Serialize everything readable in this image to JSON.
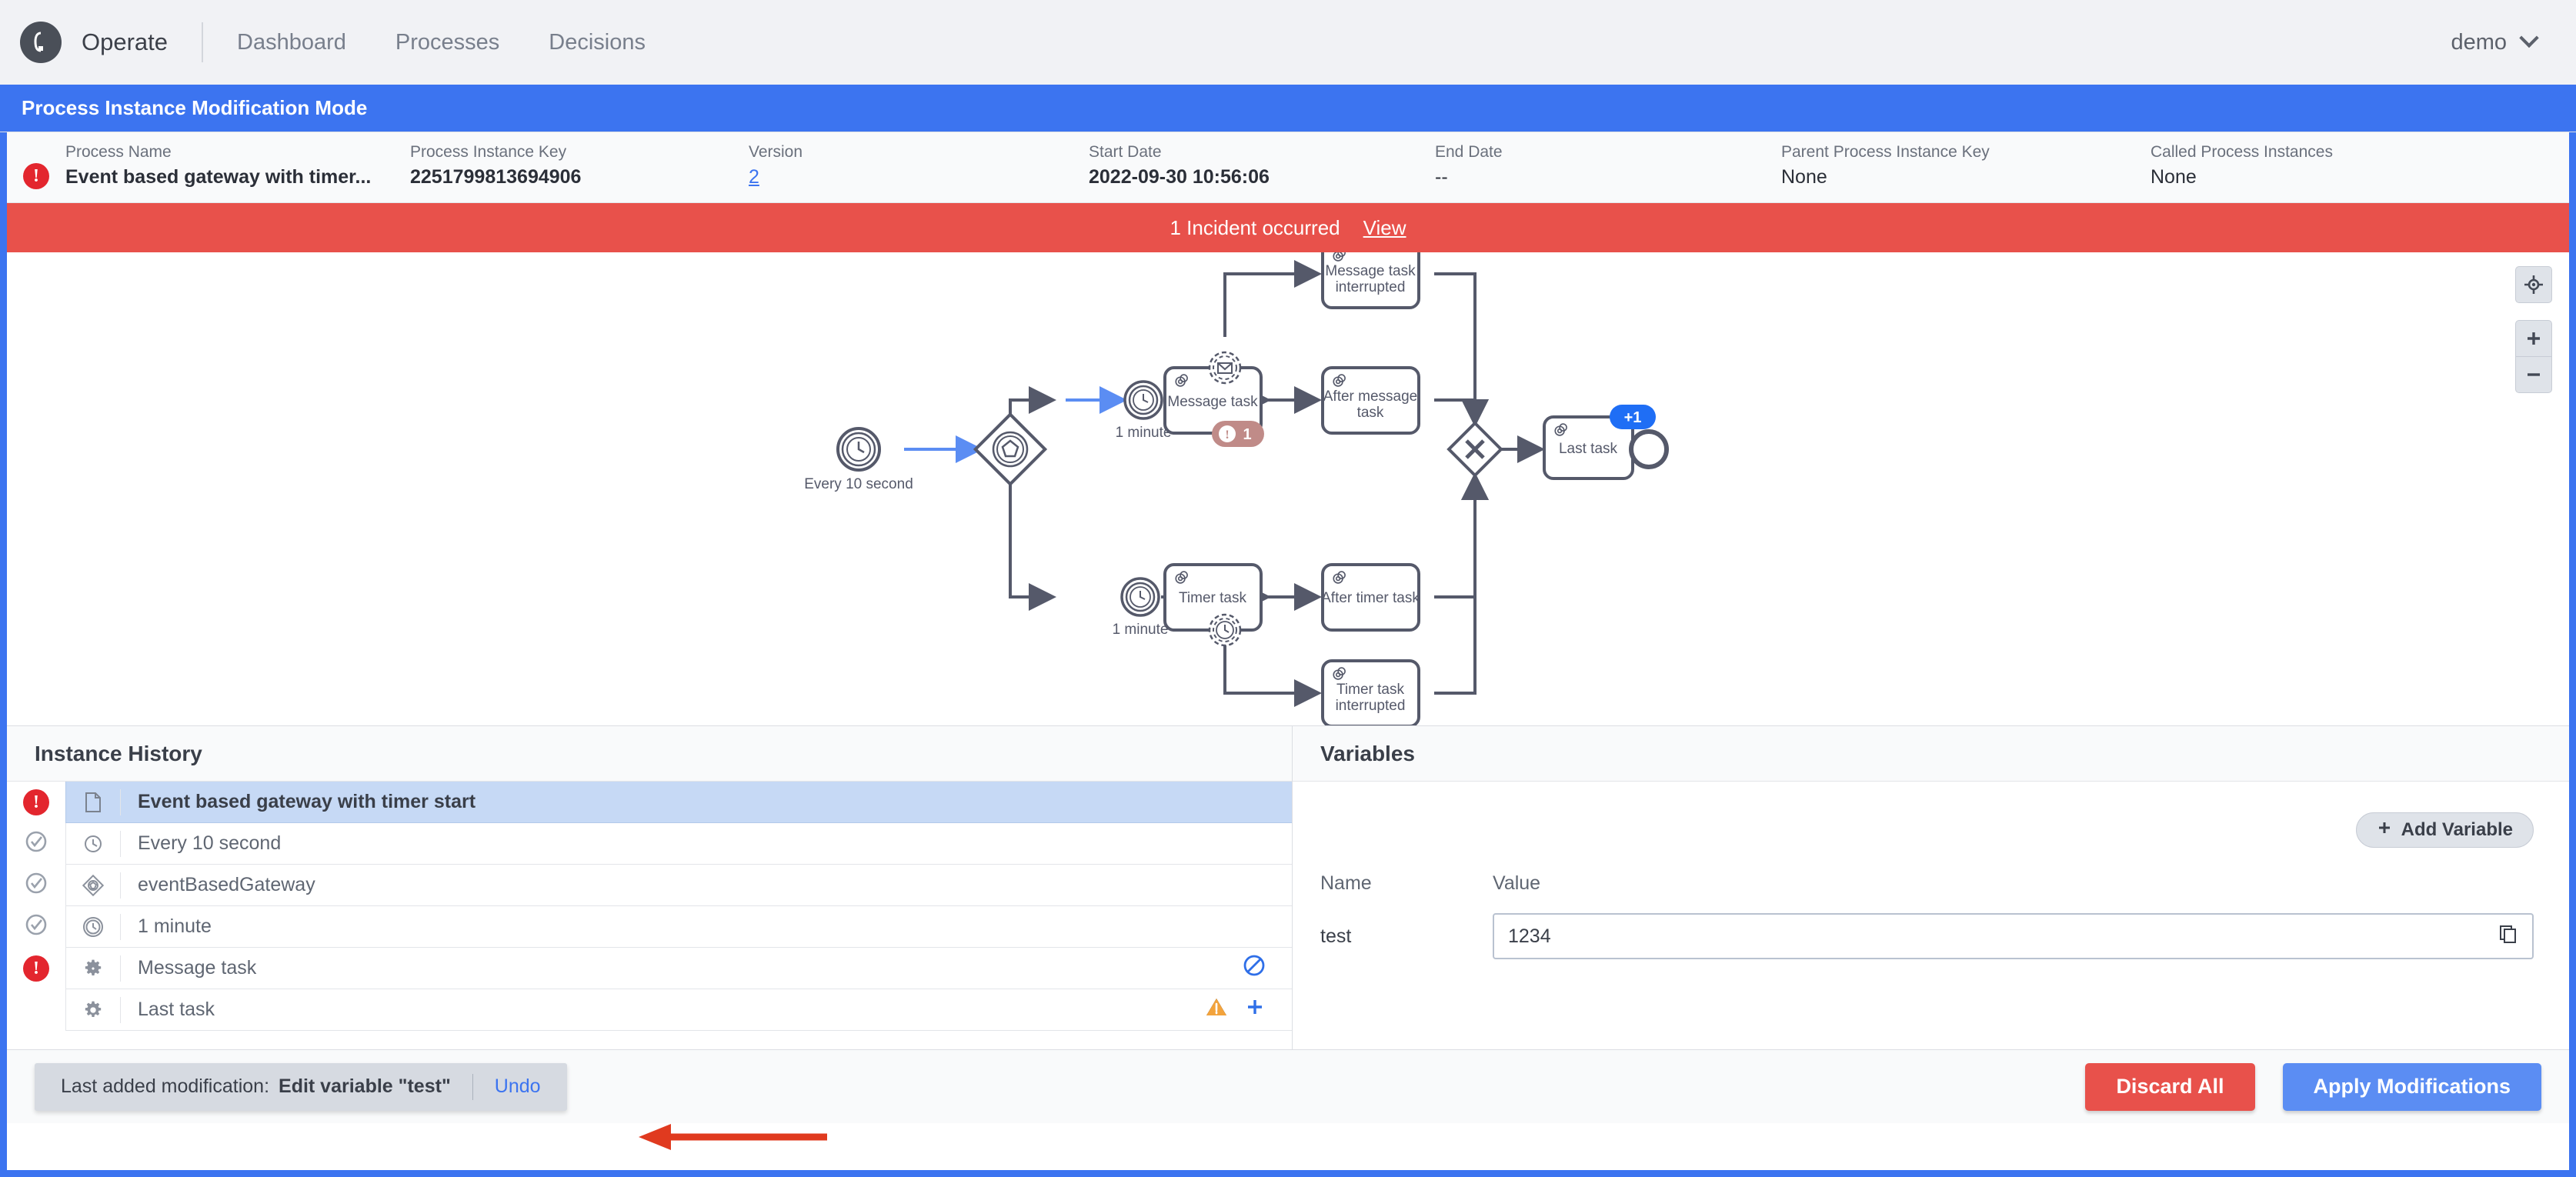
{
  "nav": {
    "logo": "camunda-logo-icon",
    "app_title": "Operate",
    "links": [
      "Dashboard",
      "Processes",
      "Decisions"
    ],
    "user": "demo"
  },
  "modification_banner": {
    "title": "Process Instance Modification Mode"
  },
  "meta": {
    "state_icon": "incident-error-icon",
    "fields": [
      {
        "label": "Process Name",
        "value": "Event based gateway with timer..."
      },
      {
        "label": "Process Instance Key",
        "value": "2251799813694906"
      },
      {
        "label": "Version",
        "value": "2",
        "link": true
      },
      {
        "label": "Start Date",
        "value": "2022-09-30 10:56:06"
      },
      {
        "label": "End Date",
        "value": "--"
      },
      {
        "label": "Parent Process Instance Key",
        "value": "None"
      },
      {
        "label": "Called Process Instances",
        "value": "None"
      }
    ]
  },
  "incident": {
    "text": "1 Incident occurred",
    "action": "View"
  },
  "diagram": {
    "nodes": [
      {
        "id": "start",
        "type": "timer-start-event",
        "label": "Every 10 second"
      },
      {
        "id": "gateway",
        "type": "event-based-gateway",
        "label": ""
      },
      {
        "id": "timer-top",
        "type": "timer-intermediate-event",
        "label": "1 minute"
      },
      {
        "id": "msg-task",
        "type": "service-task",
        "label": "Message task",
        "boundary": "message-boundary-event",
        "incident_count": "1"
      },
      {
        "id": "msg-task-interrupted",
        "type": "service-task",
        "label": "Message task interrupted"
      },
      {
        "id": "after-msg-task",
        "type": "service-task",
        "label": "After message task"
      },
      {
        "id": "timer-bottom",
        "type": "timer-intermediate-event",
        "label": "1 minute"
      },
      {
        "id": "timer-task",
        "type": "service-task",
        "label": "Timer task",
        "boundary": "timer-boundary-event"
      },
      {
        "id": "after-timer-task",
        "type": "service-task",
        "label": "After timer task"
      },
      {
        "id": "timer-task-interrupted",
        "type": "service-task",
        "label": "Timer task interrupted"
      },
      {
        "id": "merge-gateway",
        "type": "exclusive-gateway",
        "label": ""
      },
      {
        "id": "last-task",
        "type": "service-task",
        "label": "Last task",
        "badge": "+1"
      },
      {
        "id": "end",
        "type": "end-event",
        "label": ""
      }
    ],
    "controls": {
      "reset": "reset-zoom-icon",
      "zoom_in": "+",
      "zoom_out": "−"
    },
    "colors": {
      "active_flow": "#5b8df3",
      "badge": "#1f6ef5",
      "incident_badge": "#c08b88"
    }
  },
  "history": {
    "title": "Instance History",
    "rows": [
      {
        "state": "incident",
        "icon": "process-instance-icon",
        "label": "Event based gateway with timer start",
        "selected": true,
        "indent": 0
      },
      {
        "state": "completed",
        "icon": "timer-event-icon",
        "label": "Every 10 second",
        "indent": 1
      },
      {
        "state": "completed",
        "icon": "event-based-gateway-icon",
        "label": "eventBasedGateway",
        "indent": 1
      },
      {
        "state": "completed",
        "icon": "timer-intermediate-icon",
        "label": "1 minute",
        "indent": 1
      },
      {
        "state": "incident",
        "icon": "service-task-icon",
        "label": "Message task",
        "indent": 1,
        "right_icons": [
          "cancel-token-icon"
        ]
      },
      {
        "state": "none",
        "icon": "service-task-icon",
        "label": "Last task",
        "indent": 1,
        "right_icons": [
          "warning-icon",
          "add-token-icon"
        ]
      }
    ]
  },
  "variables": {
    "title": "Variables",
    "add_button": "Add Variable",
    "columns": {
      "name": "Name",
      "value": "Value"
    },
    "rows": [
      {
        "name": "test",
        "value": "1234",
        "copy_icon": "copy-icon"
      }
    ]
  },
  "footer": {
    "toast_prefix": "Last added modification:",
    "toast_modification": "Edit variable \"test\"",
    "undo": "Undo",
    "discard": "Discard All",
    "apply": "Apply Modifications"
  },
  "annotation": {
    "arrow": "red-arrow-pointer"
  }
}
